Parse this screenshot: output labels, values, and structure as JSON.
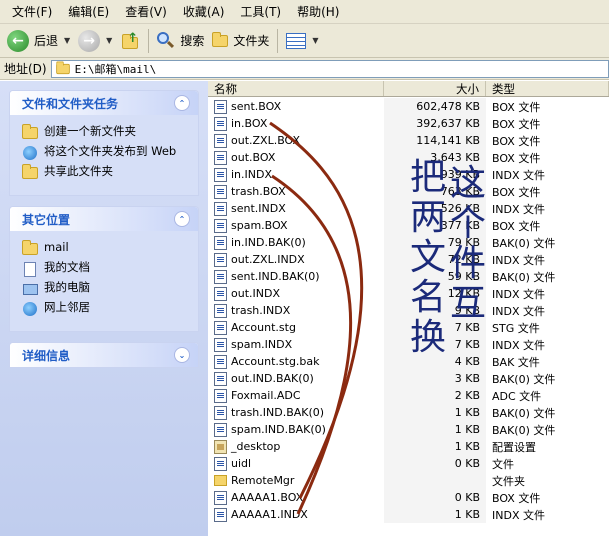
{
  "menubar": {
    "items": [
      "文件(F)",
      "编辑(E)",
      "查看(V)",
      "收藏(A)",
      "工具(T)",
      "帮助(H)"
    ]
  },
  "toolbar": {
    "back": "后退",
    "search": "搜索",
    "folders": "文件夹"
  },
  "address": {
    "label": "地址(D)",
    "path": "E:\\邮箱\\mail\\"
  },
  "left": {
    "tasks": {
      "title": "文件和文件夹任务",
      "items": [
        {
          "label": "创建一个新文件夹",
          "icon": "new-folder-icon"
        },
        {
          "label": "将这个文件夹发布到 Web",
          "icon": "publish-web-icon"
        },
        {
          "label": "共享此文件夹",
          "icon": "share-folder-icon"
        }
      ]
    },
    "places": {
      "title": "其它位置",
      "items": [
        {
          "label": "mail",
          "icon": "folder-icon"
        },
        {
          "label": "我的文档",
          "icon": "my-documents-icon"
        },
        {
          "label": "我的电脑",
          "icon": "my-computer-icon"
        },
        {
          "label": "网上邻居",
          "icon": "network-icon"
        }
      ]
    },
    "details": {
      "title": "详细信息"
    }
  },
  "list": {
    "columns": {
      "name": "名称",
      "size": "大小",
      "type": "类型"
    },
    "rows": [
      {
        "name": "sent.BOX",
        "size": "602,478 KB",
        "type": "BOX 文件",
        "icon": "file"
      },
      {
        "name": "in.BOX",
        "size": "392,637 KB",
        "type": "BOX 文件",
        "icon": "file"
      },
      {
        "name": "out.ZXL.BOX",
        "size": "114,141 KB",
        "type": "BOX 文件",
        "icon": "file"
      },
      {
        "name": "out.BOX",
        "size": "3,643 KB",
        "type": "BOX 文件",
        "icon": "file"
      },
      {
        "name": "in.INDX",
        "size": "939 KB",
        "type": "INDX 文件",
        "icon": "file"
      },
      {
        "name": "trash.BOX",
        "size": "763 KB",
        "type": "BOX 文件",
        "icon": "file"
      },
      {
        "name": "sent.INDX",
        "size": "526 KB",
        "type": "INDX 文件",
        "icon": "file"
      },
      {
        "name": "spam.BOX",
        "size": "377 KB",
        "type": "BOX 文件",
        "icon": "file"
      },
      {
        "name": "in.IND.BAK(0)",
        "size": "79 KB",
        "type": "BAK(0) 文件",
        "icon": "file"
      },
      {
        "name": "out.ZXL.INDX",
        "size": "72 KB",
        "type": "INDX 文件",
        "icon": "file"
      },
      {
        "name": "sent.IND.BAK(0)",
        "size": "59 KB",
        "type": "BAK(0) 文件",
        "icon": "file"
      },
      {
        "name": "out.INDX",
        "size": "12 KB",
        "type": "INDX 文件",
        "icon": "file"
      },
      {
        "name": "trash.INDX",
        "size": "9 KB",
        "type": "INDX 文件",
        "icon": "file"
      },
      {
        "name": "Account.stg",
        "size": "7 KB",
        "type": "STG 文件",
        "icon": "file"
      },
      {
        "name": "spam.INDX",
        "size": "7 KB",
        "type": "INDX 文件",
        "icon": "file"
      },
      {
        "name": "Account.stg.bak",
        "size": "4 KB",
        "type": "BAK 文件",
        "icon": "file"
      },
      {
        "name": "out.IND.BAK(0)",
        "size": "3 KB",
        "type": "BAK(0) 文件",
        "icon": "file"
      },
      {
        "name": "Foxmail.ADC",
        "size": "2 KB",
        "type": "ADC 文件",
        "icon": "file"
      },
      {
        "name": "trash.IND.BAK(0)",
        "size": "1 KB",
        "type": "BAK(0) 文件",
        "icon": "file"
      },
      {
        "name": "spam.IND.BAK(0)",
        "size": "1 KB",
        "type": "BAK(0) 文件",
        "icon": "file"
      },
      {
        "name": "_desktop",
        "size": "1 KB",
        "type": "配置设置",
        "icon": "cfg"
      },
      {
        "name": "uidl",
        "size": "0 KB",
        "type": "文件",
        "icon": "file"
      },
      {
        "name": "RemoteMgr",
        "size": "",
        "type": "文件夹",
        "icon": "folder"
      },
      {
        "name": "AAAAA1.BOX",
        "size": "0 KB",
        "type": "BOX 文件",
        "icon": "file"
      },
      {
        "name": "AAAAA1.INDX",
        "size": "1 KB",
        "type": "INDX 文件",
        "icon": "file"
      }
    ]
  },
  "annotation": {
    "text_col1": [
      "把",
      "两",
      "文",
      "名",
      "换"
    ],
    "text_col2": [
      "这",
      "个",
      "件",
      "互"
    ],
    "line_color": "#8b2a10",
    "text_color": "#1b2a7a"
  }
}
